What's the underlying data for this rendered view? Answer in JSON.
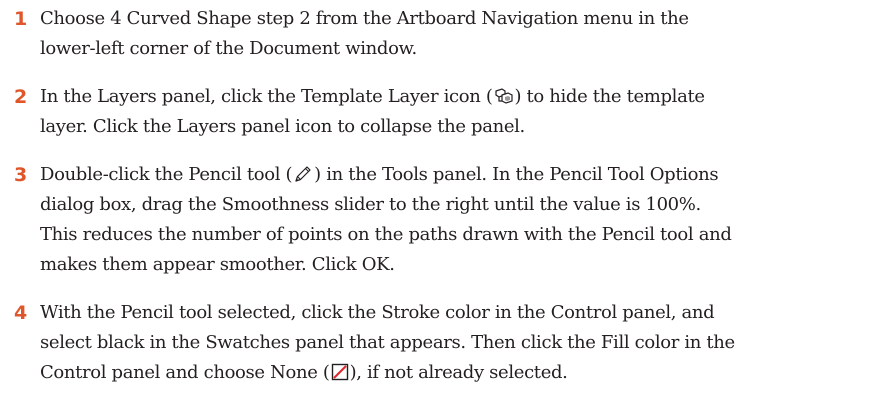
{
  "steps": [
    {
      "number": "1",
      "lines": [
        "Choose 4 Curved Shape step 2 from the Artboard Navigation menu in the",
        "lower-left corner of the Document window."
      ]
    },
    {
      "number": "2",
      "line1_pre": "In the Layers panel, click the Template Layer icon (",
      "line1_icon": "template-layer-icon",
      "line1_post": ") to hide the template",
      "line2": "layer. Click the Layers panel icon to collapse the panel."
    },
    {
      "number": "3",
      "line1_pre": "Double-click the Pencil tool (",
      "line1_icon": "pencil-tool-icon",
      "line1_post": ") in the Tools panel. In the Pencil Tool Options",
      "lines_rest": [
        "dialog box, drag the Smoothness slider to the right until the value is 100%.",
        "This reduces the number of points on the paths drawn with the Pencil tool and",
        "makes them appear smoother. Click OK."
      ]
    },
    {
      "number": "4",
      "lines_first": [
        "With the Pencil tool selected, click the Stroke color in the Control panel, and",
        "select black in the Swatches panel that appears. Then click the Fill color in the"
      ],
      "line3_pre": "Control panel and choose None (",
      "line3_icon": "none-swatch-icon",
      "line3_post": "), if not already selected."
    }
  ],
  "colors": {
    "step_number": "#e0562b",
    "body_text": "#231f20",
    "none_swatch_slash": "#e0262b"
  }
}
